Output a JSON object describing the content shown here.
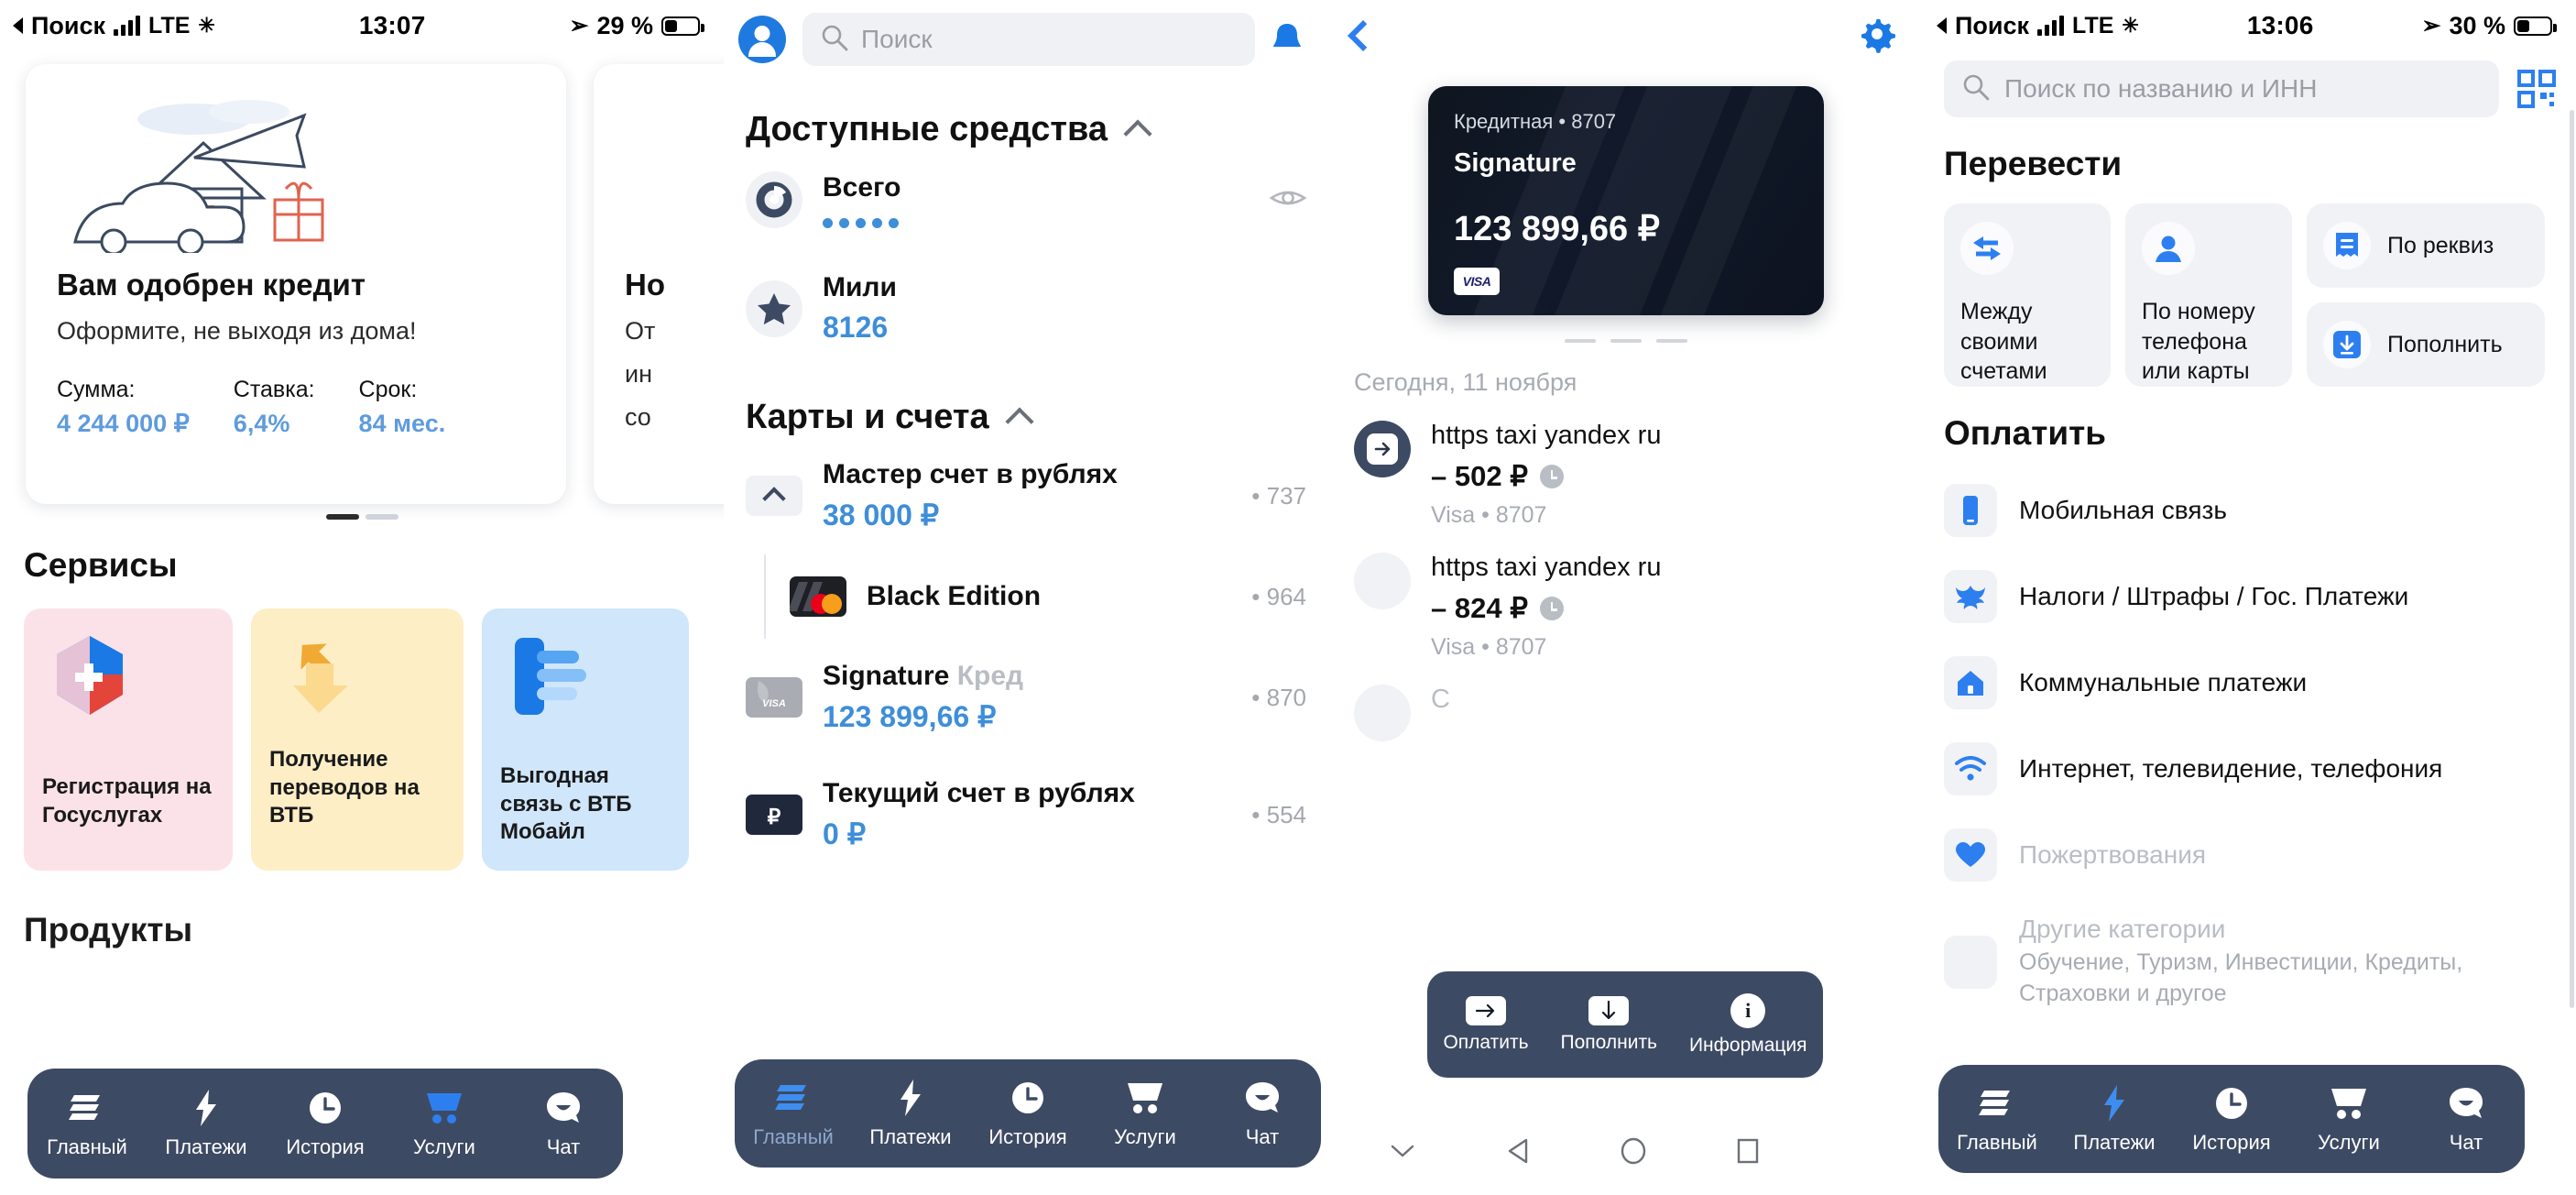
{
  "colors": {
    "brand_blue": "#2d7ff0",
    "value_blue": "#3e8ed8",
    "nav_dark": "#3d4a63",
    "card_dark": "#10161f",
    "muted": "#a7abb2"
  },
  "panel1": {
    "statusbar": {
      "carrier_back": "Поиск",
      "network": "LTE",
      "time": "13:07",
      "battery_pct": "29 %"
    },
    "promo": {
      "title": "Вам одобрен кредит",
      "subtitle": "Оформите, не выходя из дома!",
      "stats": [
        {
          "label": "Сумма:",
          "value": "4 244 000 ₽"
        },
        {
          "label": "Ставка:",
          "value": "6,4%"
        },
        {
          "label": "Срок:",
          "value": "84 мес."
        }
      ],
      "next_card_title": "Но",
      "next_card_lines": [
        "От",
        "ин",
        "со"
      ]
    },
    "services_title": "Сервисы",
    "services": [
      {
        "label": "Регистрация на Госуслугах",
        "icon": "gosuslugi-icon"
      },
      {
        "label": "Получение переводов на ВТБ",
        "icon": "transfer-arrows-icon"
      },
      {
        "label": "Выгодная связь с ВТБ Мобайл",
        "icon": "vtb-mobile-icon"
      }
    ],
    "products_title": "Продукты",
    "nav": [
      {
        "label": "Главный",
        "icon": "stack-icon",
        "active": false
      },
      {
        "label": "Платежи",
        "icon": "bolt-icon",
        "active": false
      },
      {
        "label": "История",
        "icon": "clock-icon",
        "active": false
      },
      {
        "label": "Услуги",
        "icon": "cart-icon",
        "active": true
      },
      {
        "label": "Чат",
        "icon": "chat-icon",
        "active": false
      }
    ]
  },
  "panel2": {
    "search_placeholder": "Поиск",
    "available_funds": {
      "title": "Доступные средства",
      "collapse": "chevron-up-icon"
    },
    "funds_rows": [
      {
        "name": "Всего",
        "value": "•••••",
        "masked": true,
        "icon": "donut-chart-icon",
        "action": "eye-icon"
      },
      {
        "name": "Мили",
        "value": "8126",
        "masked": false,
        "icon": "star-icon"
      }
    ],
    "cards_section": {
      "title": "Карты и счета",
      "collapse": "chevron-up-icon"
    },
    "accounts": [
      {
        "name": "Мастер счет в рублях",
        "value": "38 000 ₽",
        "tail": "• 737",
        "icon": "chevron-up-box-icon",
        "indent": false
      },
      {
        "name": "Black Edition",
        "value": "",
        "tail": "• 964",
        "icon": "mastercard-black-icon",
        "indent": true
      },
      {
        "name": "Signature",
        "name_muted": " Кред",
        "value": "123 899,66 ₽",
        "tail": "• 870",
        "icon": "visa-grey-icon",
        "indent": false
      },
      {
        "name": "Текущий счет в рублях",
        "value": "0 ₽",
        "tail": "• 554",
        "icon": "ruble-icon",
        "indent": false
      }
    ],
    "nav": [
      {
        "label": "Главный",
        "icon": "stack-icon",
        "active": true
      },
      {
        "label": "Платежи",
        "icon": "bolt-icon",
        "active": false
      },
      {
        "label": "История",
        "icon": "clock-icon",
        "active": false
      },
      {
        "label": "Услуги",
        "icon": "cart-icon",
        "active": false
      },
      {
        "label": "Чат",
        "icon": "chat-icon",
        "active": false
      }
    ]
  },
  "panel3": {
    "back": "chevron-left-icon",
    "settings": "gear-icon",
    "card": {
      "type_line": "Кредитная • 8707",
      "name": "Signature",
      "amount": "123 899,66 ₽",
      "network": "VISA"
    },
    "day_label": "Сегодня, 11 ноября",
    "transactions": [
      {
        "merchant": "https  taxi yandex ru",
        "amount": "– 502 ₽",
        "source": "Visa • 8707",
        "icon": "arrow-right-circle-icon",
        "pending": true
      },
      {
        "merchant": "https  taxi yandex ru",
        "amount": "– 824 ₽",
        "source": "Visa • 8707",
        "icon": "blank-circle-icon",
        "pending": true
      }
    ],
    "fab": [
      {
        "label": "Оплатить",
        "icon": "arrow-right-icon"
      },
      {
        "label": "Пополнить",
        "icon": "arrow-down-icon"
      },
      {
        "label": "Информация",
        "icon": "info-icon"
      }
    ],
    "android_nav": [
      "chevron-down-icon",
      "back-triangle-icon",
      "home-circle-icon",
      "recents-square-icon"
    ]
  },
  "panel4": {
    "statusbar": {
      "carrier_back": "Поиск",
      "network": "LTE",
      "time": "13:06",
      "battery_pct": "30 %"
    },
    "search_placeholder": "Поиск по названию и ИНН",
    "qr_icon": "qr-scan-icon",
    "transfer_title": "Перевести",
    "transfer_tiles": [
      {
        "label": "Между своими счетами",
        "icon": "swap-arrows-icon"
      },
      {
        "label": "По номеру телефона или карты",
        "icon": "person-icon"
      }
    ],
    "transfer_side": [
      {
        "label": "По реквиз",
        "icon": "receipt-icon"
      },
      {
        "label": "Пополнить",
        "icon": "download-box-icon"
      }
    ],
    "pay_title": "Оплатить",
    "pay_items": [
      {
        "label": "Мобильная связь",
        "icon": "phone-icon"
      },
      {
        "label": "Налоги / Штрафы / Гос. Платежи",
        "icon": "eagle-icon"
      },
      {
        "label": "Коммунальные платежи",
        "icon": "house-icon"
      },
      {
        "label": "Интернет, телевидение, телефония",
        "icon": "wifi-icon"
      },
      {
        "label": "Пожертвования",
        "icon": "heart-icon"
      }
    ],
    "other_categories": {
      "label": "Другие категории",
      "sub": "Обучение, Туризм, Инвестиции, Кредиты, Страховки и другое"
    },
    "nav": [
      {
        "label": "Главный",
        "icon": "stack-icon",
        "active": false
      },
      {
        "label": "Платежи",
        "icon": "bolt-icon",
        "active": true
      },
      {
        "label": "История",
        "icon": "clock-icon",
        "active": false
      },
      {
        "label": "Услуги",
        "icon": "cart-icon",
        "active": false
      },
      {
        "label": "Чат",
        "icon": "chat-icon",
        "active": false
      }
    ]
  }
}
